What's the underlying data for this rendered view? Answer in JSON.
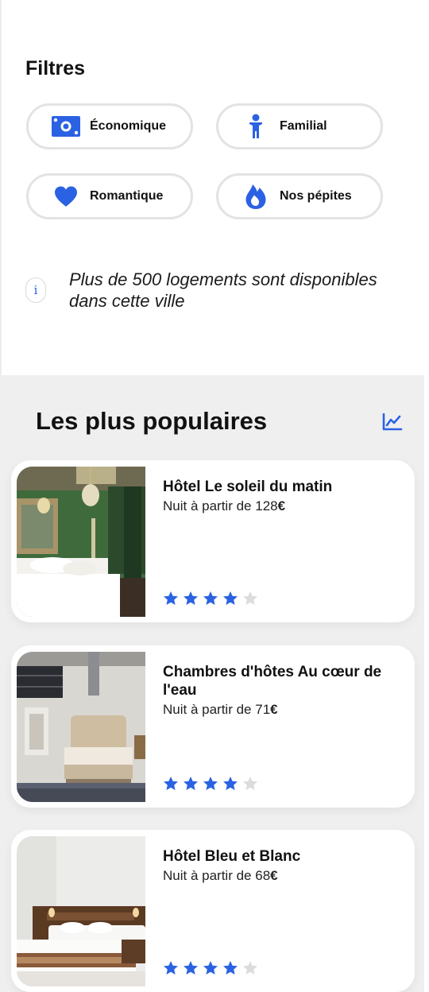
{
  "filters": {
    "title": "Filtres",
    "chips": [
      {
        "label": "Économique",
        "icon": "money-bill-icon"
      },
      {
        "label": "Familial",
        "icon": "child-icon"
      },
      {
        "label": "Romantique",
        "icon": "heart-icon"
      },
      {
        "label": "Nos pépites",
        "icon": "fire-icon"
      }
    ],
    "accent_color": "#2b62e3"
  },
  "info": {
    "icon": "info-icon",
    "text": "Plus de 500 logements sont disponibles dans cette ville"
  },
  "popular": {
    "title": "Les plus populaires",
    "chart_icon": "chart-line-icon",
    "price_prefix": "Nuit à partir de ",
    "currency": "€",
    "hotels": [
      {
        "name": "Hôtel Le soleil du matin",
        "price": "128",
        "rating": 4,
        "max_rating": 5
      },
      {
        "name": "Chambres d'hôtes Au cœur de l'eau",
        "price": "71",
        "rating": 4,
        "max_rating": 5
      },
      {
        "name": "Hôtel Bleu et Blanc",
        "price": "68",
        "rating": 4,
        "max_rating": 5
      }
    ]
  }
}
